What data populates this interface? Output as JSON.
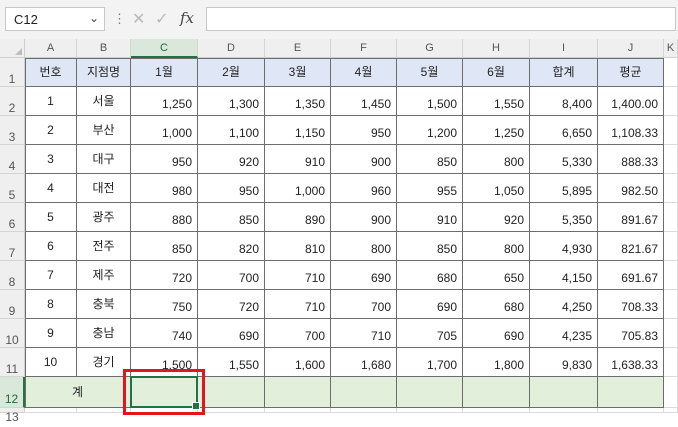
{
  "formula_bar": {
    "name_box": "C12",
    "name_box_caret": "⌄",
    "separator": "⋮",
    "cancel_icon": "✕",
    "enter_icon": "✓",
    "function_icon": "fx",
    "formula": ""
  },
  "columns": [
    "A",
    "B",
    "C",
    "D",
    "E",
    "F",
    "G",
    "H",
    "I",
    "J",
    "K"
  ],
  "rows": [
    "1",
    "2",
    "3",
    "4",
    "5",
    "6",
    "7",
    "8",
    "9",
    "10",
    "11",
    "12",
    "13"
  ],
  "selected_cell": "C12",
  "table": {
    "headers": [
      "번호",
      "지점명",
      "1월",
      "2월",
      "3월",
      "4월",
      "5월",
      "6월",
      "합계",
      "평균"
    ],
    "data": [
      [
        "1",
        "서울",
        "1,250",
        "1,300",
        "1,350",
        "1,450",
        "1,500",
        "1,550",
        "8,400",
        "1,400.00"
      ],
      [
        "2",
        "부산",
        "1,000",
        "1,100",
        "1,150",
        "950",
        "1,200",
        "1,250",
        "6,650",
        "1,108.33"
      ],
      [
        "3",
        "대구",
        "950",
        "920",
        "910",
        "900",
        "850",
        "800",
        "5,330",
        "888.33"
      ],
      [
        "4",
        "대전",
        "980",
        "950",
        "1,000",
        "960",
        "955",
        "1,050",
        "5,895",
        "982.50"
      ],
      [
        "5",
        "광주",
        "880",
        "850",
        "890",
        "900",
        "910",
        "920",
        "5,350",
        "891.67"
      ],
      [
        "6",
        "전주",
        "850",
        "820",
        "810",
        "800",
        "850",
        "800",
        "4,930",
        "821.67"
      ],
      [
        "7",
        "제주",
        "720",
        "700",
        "710",
        "690",
        "680",
        "650",
        "4,150",
        "691.67"
      ],
      [
        "8",
        "충북",
        "750",
        "720",
        "710",
        "700",
        "690",
        "680",
        "4,250",
        "708.33"
      ],
      [
        "9",
        "충남",
        "740",
        "690",
        "700",
        "710",
        "705",
        "690",
        "4,235",
        "705.83"
      ],
      [
        "10",
        "경기",
        "1,500",
        "1,550",
        "1,600",
        "1,680",
        "1,700",
        "1,800",
        "9,830",
        "1,638.33"
      ]
    ],
    "total_label": "계",
    "total_values": [
      "",
      "",
      "",
      "",
      "",
      "",
      "",
      ""
    ]
  },
  "colors": {
    "header_fill": "#dfe6f6",
    "total_fill": "#e2efda",
    "selection": "#217346",
    "highlight": "#e3141c"
  }
}
